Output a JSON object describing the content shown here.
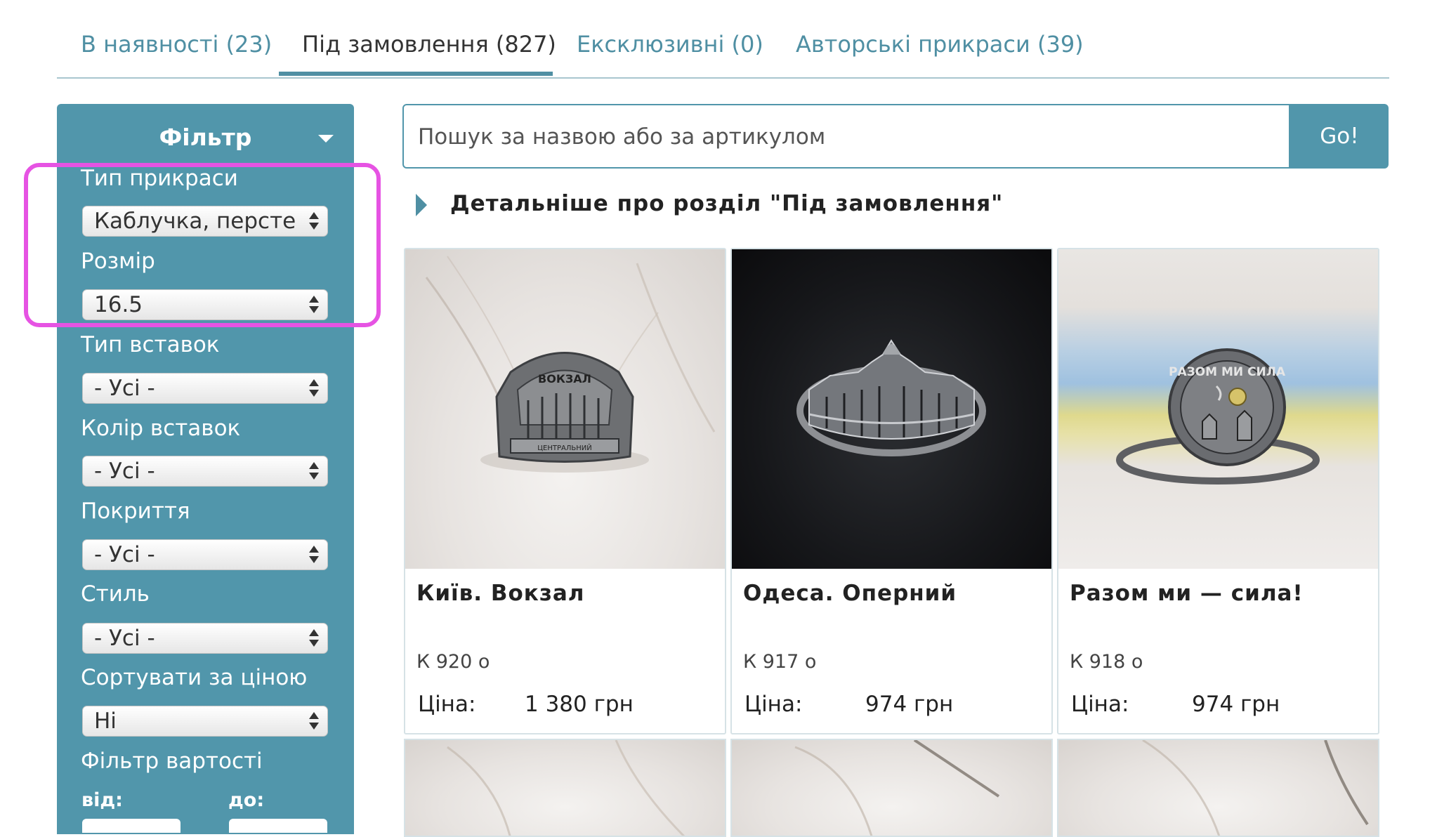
{
  "tabs": [
    {
      "label": "В наявності (23)"
    },
    {
      "label": "Під замовлення (827)"
    },
    {
      "label": "Ексклюзивні (0)"
    },
    {
      "label": "Авторські прикраси (39)"
    }
  ],
  "filter": {
    "title": "Фільтр",
    "groups": [
      {
        "label": "Тип прикраси",
        "value": "Каблучка, перстень"
      },
      {
        "label": "Розмір",
        "value": "16.5"
      },
      {
        "label": "Тип вставок",
        "value": "- Усі -"
      },
      {
        "label": "Колір вставок",
        "value": "- Усі -"
      },
      {
        "label": "Покриття",
        "value": "- Усі -"
      },
      {
        "label": "Стиль",
        "value": "- Усі -"
      },
      {
        "label": "Сортувати за ціною",
        "value": "Ні"
      }
    ],
    "price_filter_label": "Фільтр вартості",
    "from_label": "від:",
    "to_label": "до:"
  },
  "search": {
    "placeholder": "Пошук за назвою або за артикулом",
    "button": "Go!"
  },
  "detail_link": "Детальніше про розділ \"Під замовлення\"",
  "products": [
    {
      "name": "Київ. Вокзал",
      "sku": "К 920 о",
      "price_label": "Ціна:",
      "price": "1 380 грн",
      "ring_text": "ВОКЗАЛ",
      "ring_subtext": "ЦЕНТРАЛЬНИЙ"
    },
    {
      "name": "Одеса. Оперний",
      "sku": "К 917 о",
      "price_label": "Ціна:",
      "price": "974 грн"
    },
    {
      "name": "Разом ми — сила!",
      "sku": "К 918 о",
      "price_label": "Ціна:",
      "price": "974 грн",
      "ring_text": "РАЗОМ МИ СИЛА"
    }
  ],
  "colors": {
    "accent": "#5196ab",
    "tab_text": "#4f8fa3",
    "highlight": "#e653e3"
  }
}
